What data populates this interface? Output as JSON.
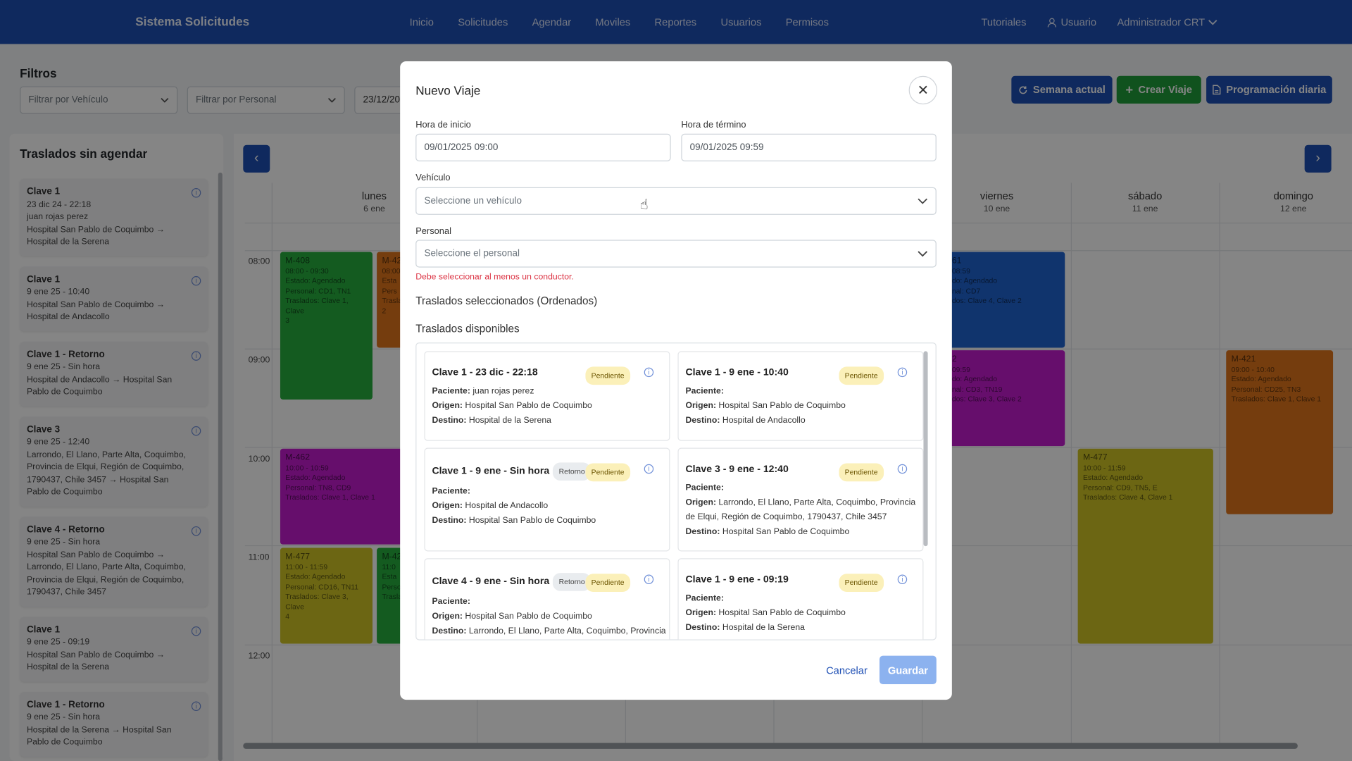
{
  "nav": {
    "brand": "Sistema Solicitudes",
    "menu": [
      "Inicio",
      "Solicitudes",
      "Agendar",
      "Moviles",
      "Reportes",
      "Usuarios",
      "Permisos"
    ],
    "tutorials": "Tutoriales",
    "user": "Usuario",
    "admin": "Administrador CRT"
  },
  "filters": {
    "title": "Filtros",
    "vehicle_placeholder": "Filtrar por Vehículo",
    "personal_placeholder": "Filtrar por Personal",
    "date_value": "23/12/20"
  },
  "actions": {
    "current_week": "Semana actual",
    "create_trip": "Crear Viaje",
    "daily_schedule": "Programación diaria"
  },
  "unscheduled": {
    "title": "Traslados sin agendar",
    "items": [
      {
        "title": "Clave 1",
        "lines": [
          "23 dic 24 - 22:18",
          "juan rojas perez",
          "Hospital San Pablo de Coquimbo →",
          "Hospital de la Serena"
        ]
      },
      {
        "title": "Clave 1",
        "lines": [
          "9 ene 25 - 10:40",
          "Hospital San Pablo de Coquimbo →",
          "Hospital de Andacollo"
        ]
      },
      {
        "title": "Clave 1 - Retorno",
        "lines": [
          "9 ene 25 - Sin hora",
          "Hospital de Andacollo → Hospital San",
          "Pablo de Coquimbo"
        ]
      },
      {
        "title": "Clave 3",
        "lines": [
          "9 ene 25 - 12:40",
          "Larrondo, El Llano, Parte Alta, Coquimbo,",
          "Provincia de Elqui, Región de Coquimbo,",
          "1790437, Chile 3457 → Hospital San",
          "Pablo de Coquimbo"
        ]
      },
      {
        "title": "Clave 4 - Retorno",
        "lines": [
          "9 ene 25 - Sin hora",
          "Hospital San Pablo de Coquimbo →",
          "Larrondo, El Llano, Parte Alta, Coquimbo,",
          "Provincia de Elqui, Región de Coquimbo,",
          "1790437, Chile 3457"
        ]
      },
      {
        "title": "Clave 1",
        "lines": [
          "9 ene 25 - 09:19",
          "Hospital San Pablo de Coquimbo →",
          "Hospital de la Serena"
        ]
      },
      {
        "title": "Clave 1 - Retorno",
        "lines": [
          "9 ene 25 - Sin hora",
          "Hospital de la Serena → Hospital San",
          "Pablo de Coquimbo"
        ]
      }
    ]
  },
  "calendar": {
    "days": [
      {
        "name": "lunes",
        "date": "6 ene"
      },
      {
        "name": "viernes",
        "date": "10 ene"
      },
      {
        "name": "sábado",
        "date": "11 ene"
      },
      {
        "name": "domingo",
        "date": "12 ene"
      }
    ],
    "hours": [
      "08:00",
      "09:00",
      "10:00",
      "11:00",
      "12:00"
    ],
    "events": [
      {
        "id": "M-408",
        "lines": [
          "08:00 - 09:30",
          "Estado: Agendado",
          "Personal: CD1, TN1",
          "Traslados: Clave 1, Clave",
          "3"
        ],
        "color": "#27ae3f"
      },
      {
        "id": "M-42",
        "lines": [
          "08:00",
          "Esta",
          "Pers",
          "Trasla",
          "2"
        ],
        "color": "#e0761b"
      },
      {
        "id": "M-462",
        "lines": [
          "10:00 - 10:59",
          "Estado: Agendado",
          "Personal: TN8, CD9",
          "Traslados: Clave 1, Clave 1"
        ],
        "color": "#c41bd0"
      },
      {
        "id": "M-477",
        "lines": [
          "11:00 - 11:59",
          "Estado: Agendado",
          "Personal: CD16, TN11",
          "Traslados: Clave 3, Clave",
          "4"
        ],
        "color": "#cfc325"
      },
      {
        "id": "M-42",
        "lines": [
          "11:0",
          "Esta",
          "Perso",
          "Trasla"
        ],
        "color": "#27ae3f"
      },
      {
        "id": "61",
        "lines": [
          "08:59",
          "do: Agendado",
          "nal: CD7",
          "dos: Clave 4, Clave 2"
        ],
        "color": "#1f64d1"
      },
      {
        "id": "2",
        "lines": [
          "09:59",
          "do: Agendado",
          "nal: CD3, TN19",
          "dos: Clave 3, Clave 2"
        ],
        "color": "#c41bd0"
      },
      {
        "id": "M-477",
        "lines": [
          "10:00 - 11:59",
          "Estado: Agendado",
          "Personal: CD9, TN5, E",
          "Traslados: Clave 4, Clave 1"
        ],
        "color": "#cfc325"
      },
      {
        "id": "M-421",
        "lines": [
          "09:00 - 10:40",
          "Estado: Agendado",
          "Personal: CD25, TN3",
          "Traslados: Clave 1, Clave 1"
        ],
        "color": "#e0761b"
      }
    ]
  },
  "modal": {
    "title": "Nuevo Viaje",
    "start_label": "Hora de inicio",
    "start_value": "09/01/2025 09:00",
    "end_label": "Hora de término",
    "end_value": "09/01/2025 09:59",
    "vehicle_label": "Vehículo",
    "vehicle_placeholder": "Seleccione un vehículo",
    "personal_label": "Personal",
    "personal_placeholder": "Seleccione el personal",
    "error": "Debe seleccionar al menos un conductor.",
    "selected_title": "Traslados seleccionados (Ordenados)",
    "available_title": "Traslados disponibles",
    "labels": {
      "patient": "Paciente:",
      "origin": "Origen:",
      "destination": "Destino:"
    },
    "cards": [
      {
        "title": "Clave 1 - 23 dic - 22:18",
        "retorno": "",
        "status": "Pendiente",
        "patient": "juan rojas perez",
        "origin": "Hospital San Pablo de Coquimbo",
        "destination": "Hospital de la Serena"
      },
      {
        "title": "Clave 1 - 9 ene - 10:40",
        "retorno": "",
        "status": "Pendiente",
        "patient": "",
        "origin": "Hospital San Pablo de Coquimbo",
        "destination": "Hospital de Andacollo"
      },
      {
        "title": "Clave 1 - 9 ene - Sin hora",
        "retorno": "Retorno",
        "status": "Pendiente",
        "patient": "",
        "origin": "Hospital de Andacollo",
        "destination": "Hospital San Pablo de Coquimbo"
      },
      {
        "title": "Clave 3 - 9 ene - 12:40",
        "retorno": "",
        "status": "Pendiente",
        "patient": "",
        "origin": "Larrondo, El Llano, Parte Alta, Coquimbo, Provincia de Elqui, Región de Coquimbo, 1790437, Chile 3457",
        "destination": "Hospital San Pablo de Coquimbo"
      },
      {
        "title": "Clave 4 - 9 ene - Sin hora",
        "retorno": "Retorno",
        "status": "Pendiente",
        "patient": "",
        "origin": "Hospital San Pablo de Coquimbo",
        "destination": "Larrondo, El Llano, Parte Alta, Coquimbo, Provincia"
      },
      {
        "title": "Clave 1 - 9 ene - 09:19",
        "retorno": "",
        "status": "Pendiente",
        "patient": "",
        "origin": "Hospital San Pablo de Coquimbo",
        "destination": "Hospital de la Serena"
      }
    ],
    "cancel": "Cancelar",
    "save": "Guardar"
  }
}
